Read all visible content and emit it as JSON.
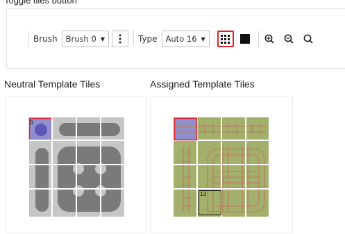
{
  "caption_top": "Toggle tiles button",
  "toolbar": {
    "brush_label": "Brush",
    "brush_value": "Brush 0",
    "type_label": "Type",
    "type_value": "Auto 16"
  },
  "sections": {
    "neutral_title": "Neutral Template Tiles",
    "assigned_title": "Assigned Template Tiles"
  },
  "tiles": {
    "neutral_selected_index": "0",
    "assigned_highlight_index": "13"
  },
  "colors": {
    "active_border": "#e0202a",
    "tile_gray": "#c6c6c6",
    "dark_gray": "#7a7a7a",
    "selection_fill": "#8f8fcf",
    "grass_green": "#a3b06b",
    "rail_brown": "#b58563"
  }
}
